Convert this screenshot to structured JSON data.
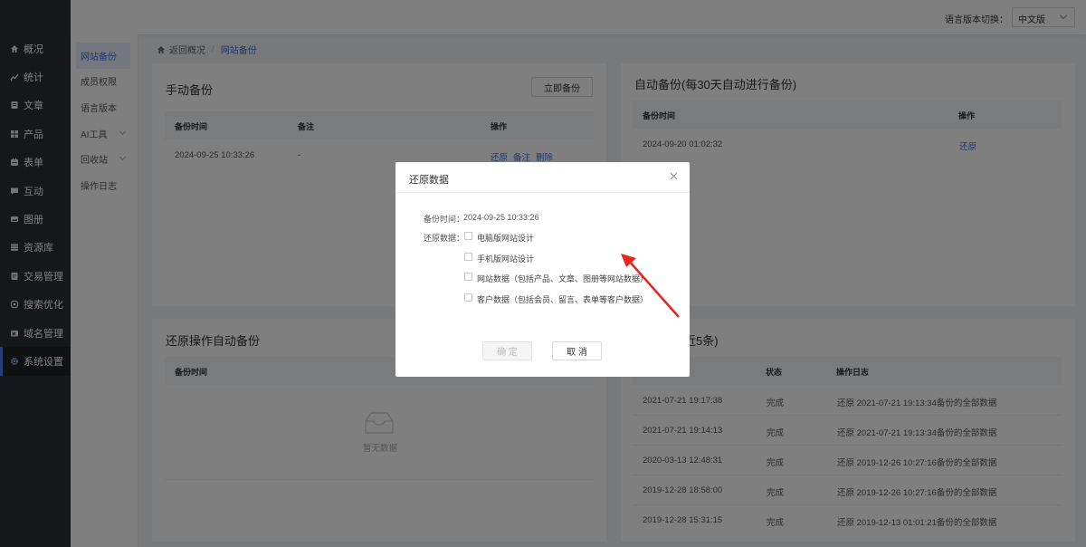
{
  "sidebar": {
    "items": [
      {
        "label": "概况",
        "icon": "home-icon"
      },
      {
        "label": "统计",
        "icon": "stats-icon"
      },
      {
        "label": "文章",
        "icon": "article-icon"
      },
      {
        "label": "产品",
        "icon": "grid-icon"
      },
      {
        "label": "表单",
        "icon": "form-icon"
      },
      {
        "label": "互动",
        "icon": "chat-icon"
      },
      {
        "label": "图册",
        "icon": "image-icon"
      },
      {
        "label": "资源库",
        "icon": "storage-icon"
      },
      {
        "label": "交易管理",
        "icon": "trade-icon"
      },
      {
        "label": "搜索优化",
        "icon": "seo-icon"
      },
      {
        "label": "域名管理",
        "icon": "domain-icon"
      },
      {
        "label": "系统设置",
        "icon": "gear-icon"
      }
    ]
  },
  "submenu": {
    "items": [
      "网站备份",
      "成员权限",
      "语言版本",
      "AI工具",
      "回收站",
      "操作日志"
    ]
  },
  "topbar": {
    "lang_label": "语言版本切换：",
    "lang_value": "中文版"
  },
  "breadcrumb": {
    "back": "返回概况",
    "sep": "/",
    "current": "网站备份"
  },
  "manual": {
    "title": "手动备份",
    "button": "立即备份",
    "headers": [
      "备份时间",
      "备注",
      "操作"
    ],
    "rows": [
      {
        "time": "2024-09-25 10:33:26",
        "note": "-",
        "actions": [
          "还原",
          "备注",
          "删除"
        ]
      }
    ]
  },
  "auto": {
    "title": "自动备份(每30天自动进行备份)",
    "headers": [
      "备份时间",
      "操作"
    ],
    "rows": [
      {
        "time": "2024-09-20 01:02:32",
        "action": "还原"
      }
    ]
  },
  "restore_auto": {
    "title": "还原操作自动备份",
    "headers": [
      "备份时间"
    ],
    "empty": "暂无数据"
  },
  "log": {
    "title_suffix": "近5条)",
    "headers": [
      "状态",
      "操作日志"
    ],
    "rows": [
      {
        "time": "2021-07-21 19:17:38",
        "status": "完成",
        "log": "还原 2021-07-21 19:13:34备份的全部数据"
      },
      {
        "time": "2021-07-21 19:14:13",
        "status": "完成",
        "log": "还原 2021-07-21 19:13:34备份的全部数据"
      },
      {
        "time": "2020-03-13 12:48:31",
        "status": "完成",
        "log": "还原 2019-12-26 10:27:16备份的全部数据"
      },
      {
        "time": "2019-12-28 18:58:00",
        "status": "完成",
        "log": "还原 2019-12-26 10:27:16备份的全部数据"
      },
      {
        "time": "2019-12-28 15:31:15",
        "status": "完成",
        "log": "还原 2019-12-13 01:01:21备份的全部数据"
      }
    ]
  },
  "modal": {
    "title": "还原数据",
    "time_label": "备份时间：",
    "time_value": "2024-09-25 10:33:26",
    "data_label": "还原数据：",
    "options": [
      "电脑版网站设计",
      "手机版网站设计",
      "网站数据（包括产品、文章、图册等网站数据）",
      "客户数据（包括会员、留言、表单等客户数据）"
    ],
    "confirm": "确 定",
    "cancel": "取 消"
  },
  "colors": {
    "accent": "#3d6de0",
    "sidebar_bg": "#2b2f36",
    "arrow": "#e8261f"
  }
}
